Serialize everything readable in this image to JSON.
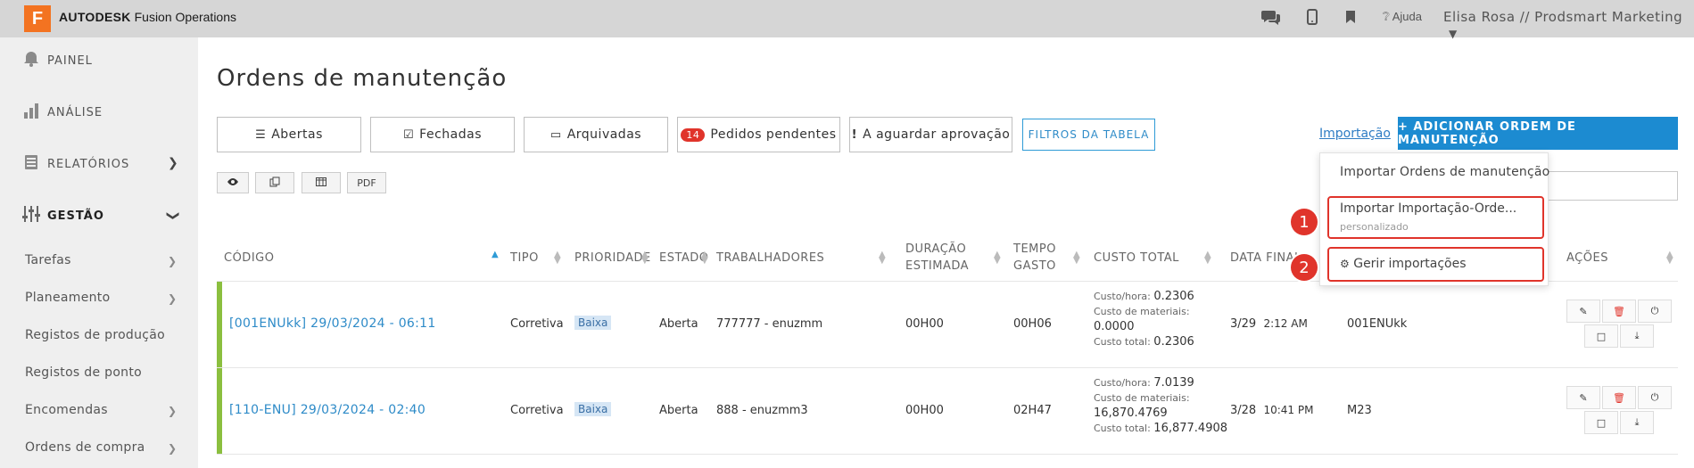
{
  "topbar": {
    "logo_letter": "F",
    "brand_bold": "AUTODESK",
    "brand_rest": " Fusion Operations",
    "icons": [
      "chat-icon",
      "mobile-icon",
      "bookmark-icon"
    ],
    "help_label": "Ajuda",
    "user_label": "Elisa Rosa // Prodsmart Marketing"
  },
  "sidebar": {
    "main": [
      {
        "label": "PAINEL",
        "icon": "bell-icon"
      },
      {
        "label": "ANÁLISE",
        "icon": "bar-chart-icon"
      },
      {
        "label": "RELATÓRIOS",
        "icon": "report-icon"
      },
      {
        "label": "GESTÃO",
        "icon": "sliders-icon"
      }
    ],
    "sub": [
      {
        "label": "Tarefas"
      },
      {
        "label": "Planeamento"
      },
      {
        "label": "Registos de produção"
      },
      {
        "label": "Registos de ponto"
      },
      {
        "label": "Encomendas"
      },
      {
        "label": "Ordens de compra"
      }
    ]
  },
  "main": {
    "title": "Ordens de manutenção",
    "tabs": [
      {
        "label": "Abertas",
        "icon": "list-icon"
      },
      {
        "label": "Fechadas",
        "icon": "check-square-icon"
      },
      {
        "label": "Arquivadas",
        "icon": "inbox-icon"
      },
      {
        "label": "Pedidos pendentes",
        "badge": "14"
      },
      {
        "label": "A aguardar aprovação",
        "icon": "exclamation-icon"
      }
    ],
    "filters_label": "FILTROS DA TABELA",
    "import_label": "Importação",
    "add_label": "+ ADICIONAR ORDEM DE MANUTENÇÃO",
    "small_buttons": [
      {
        "label": "",
        "icon": "eye-icon"
      },
      {
        "label": "",
        "icon": "copy-icon"
      },
      {
        "label": "",
        "icon": "columns-icon"
      },
      {
        "label": "PDF"
      }
    ]
  },
  "dropdown": {
    "item1": "Importar Ordens de manutenção",
    "item2": "Importar Importação-Orde...",
    "item2_sub": "personalizado",
    "item3": "Gerir importações",
    "marker1": "1",
    "marker2": "2"
  },
  "table": {
    "headers": {
      "code": "CÓDIGO",
      "type": "TIPO",
      "priority": "PRIORIDADE",
      "state": "ESTADO",
      "workers": "TRABALHADORES",
      "duration1": "DURAÇÃO",
      "duration2": "ESTIMADA",
      "time1": "TEMPO",
      "time2": "GASTO",
      "cost": "CUSTO TOTAL",
      "end": "DATA FINAL",
      "actions": "AÇÕES"
    },
    "rows": [
      {
        "code": "[001ENUkk] 29/03/2024 - 06:11",
        "type": "Corretiva",
        "priority": "Baixa",
        "state": "Aberta",
        "workers": "777777 - enuzmm",
        "duration": "00H00",
        "time": "00H06",
        "cost_hour_label": "Custo/hora:",
        "cost_hour": "0.2306",
        "cost_mat_label": "Custo de materiais:",
        "cost_mat": "0.0000",
        "cost_total_label": "Custo total:",
        "cost_total": "0.2306",
        "end_date": "3/29",
        "end_time": "2:12 AM",
        "extra": "001ENUkk"
      },
      {
        "code": "[110-ENU] 29/03/2024 - 02:40",
        "type": "Corretiva",
        "priority": "Baixa",
        "state": "Aberta",
        "workers": "888 - enuzmm3",
        "duration": "00H00",
        "time": "02H47",
        "cost_hour_label": "Custo/hora:",
        "cost_hour": "7.0139",
        "cost_mat_label": "Custo de materiais:",
        "cost_mat": "16,870.4769",
        "cost_total_label": "Custo total:",
        "cost_total": "16,877.4908",
        "end_date": "3/28",
        "end_time": "10:41 PM",
        "extra": "M23"
      }
    ]
  },
  "colors": {
    "accent": "#1c8bd1",
    "danger": "#e0342b",
    "row_bar": "#8bbf3f",
    "logo": "#f37321"
  }
}
